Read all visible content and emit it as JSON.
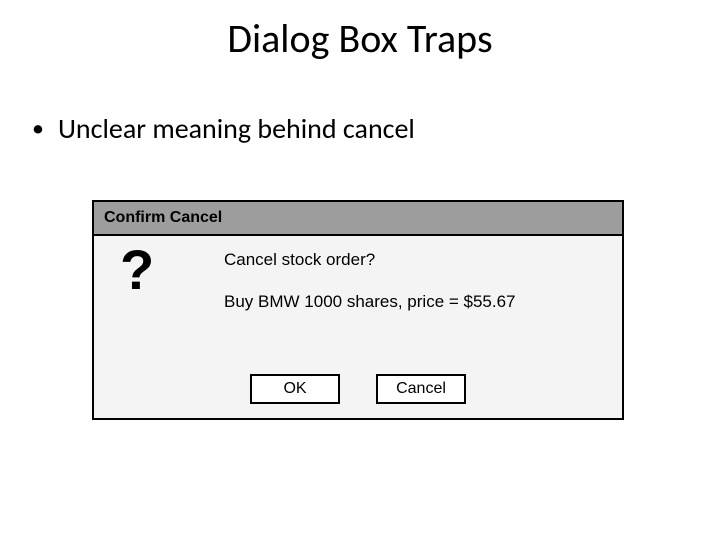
{
  "slide": {
    "title": "Dialog Box Traps",
    "bullet": "Unclear meaning behind cancel"
  },
  "dialog": {
    "title": "Confirm Cancel",
    "icon": "?",
    "message1": "Cancel stock order?",
    "message2": "Buy BMW 1000 shares, price = $55.67",
    "ok_label": "OK",
    "cancel_label": "Cancel"
  }
}
